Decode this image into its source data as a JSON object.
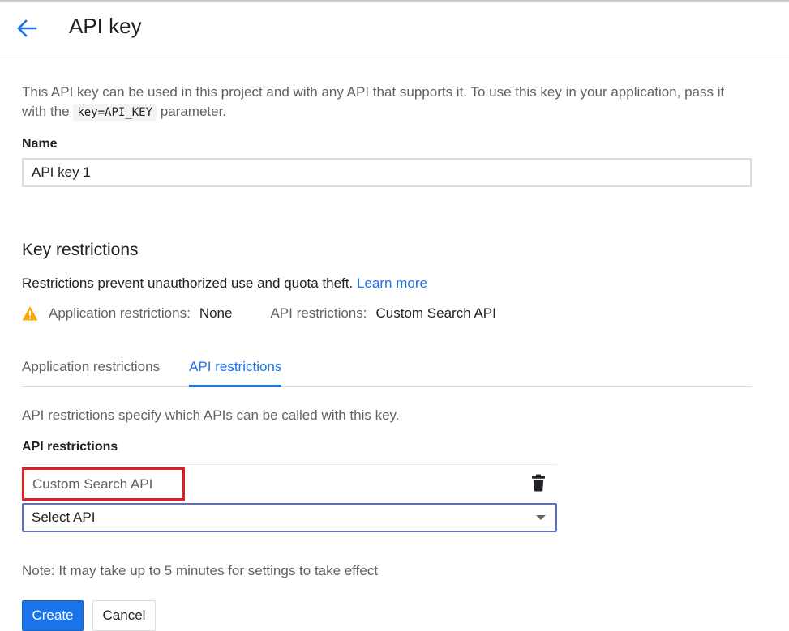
{
  "header": {
    "back_icon": "arrow-back-icon",
    "title": "API key"
  },
  "intro": {
    "text_before": "This API key can be used in this project and with any API that supports it. To use this key in your application, pass it with the ",
    "code": "key=API_KEY",
    "text_after": " parameter."
  },
  "name_field": {
    "label": "Name",
    "value": "API key 1"
  },
  "key_restrictions": {
    "title": "Key restrictions",
    "description": "Restrictions prevent unauthorized use and quota theft.",
    "learn_more": "Learn more",
    "warning_icon": "warning-icon",
    "app_restrictions_label": "Application restrictions:",
    "app_restrictions_value": "None",
    "api_restrictions_label": "API restrictions:",
    "api_restrictions_value": "Custom Search API"
  },
  "tabs": [
    {
      "label": "Application restrictions",
      "active": false
    },
    {
      "label": "API restrictions",
      "active": true
    }
  ],
  "api_restrictions": {
    "description": "API restrictions specify which APIs can be called with this key.",
    "heading": "API restrictions",
    "selected_apis": [
      {
        "name": "Custom Search API",
        "delete_icon": "trash-icon"
      }
    ],
    "select_placeholder": "Select API"
  },
  "note": "Note: It may take up to 5 minutes for settings to take effect",
  "actions": {
    "create_label": "Create",
    "cancel_label": "Cancel"
  },
  "colors": {
    "accent": "#1a73e8",
    "warning": "#f9ab00",
    "highlight_box": "#e02020"
  }
}
